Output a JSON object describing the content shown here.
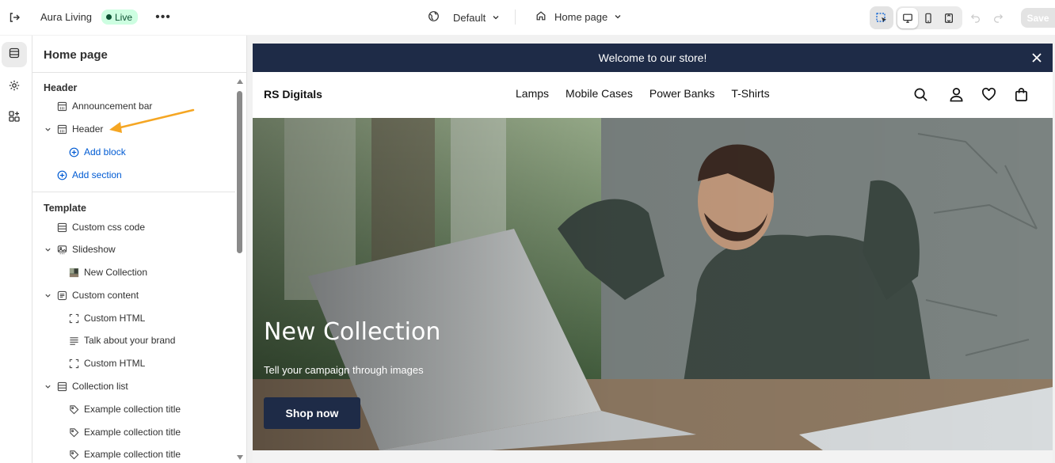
{
  "topbar": {
    "store_name": "Aura Living",
    "live_label": "Live",
    "more_label": "•••",
    "theme_selector": "Default",
    "page_selector": "Home page",
    "save_label": "Save"
  },
  "rail": {
    "items": [
      {
        "name": "sections-icon",
        "active": true
      },
      {
        "name": "settings-gear-icon",
        "active": false
      },
      {
        "name": "apps-icon",
        "active": false
      }
    ]
  },
  "panel": {
    "title": "Home page",
    "header_group": {
      "title": "Header",
      "rows": [
        {
          "label": "Announcement bar",
          "icon": "section-icon"
        },
        {
          "label": "Header",
          "icon": "section-icon",
          "expanded": true
        },
        {
          "label": "Add block",
          "icon": "plus-circle-icon",
          "link": true
        },
        {
          "label": "Add section",
          "icon": "plus-circle-icon",
          "link": true
        }
      ]
    },
    "template_group": {
      "title": "Template",
      "rows": [
        {
          "label": "Custom css code",
          "icon": "section-icon"
        },
        {
          "label": "Slideshow",
          "icon": "slideshow-icon",
          "expanded": true
        },
        {
          "label": "New Collection",
          "icon": "image-thumb-icon"
        },
        {
          "label": "Custom content",
          "icon": "content-icon",
          "expanded": true
        },
        {
          "label": "Custom HTML",
          "icon": "html-frame-icon"
        },
        {
          "label": "Talk about your brand",
          "icon": "text-lines-icon"
        },
        {
          "label": "Custom HTML",
          "icon": "html-frame-icon"
        },
        {
          "label": "Collection list",
          "icon": "section-icon",
          "expanded": true
        },
        {
          "label": "Example collection title",
          "icon": "tag-icon"
        },
        {
          "label": "Example collection title",
          "icon": "tag-icon"
        },
        {
          "label": "Example collection title",
          "icon": "tag-icon"
        }
      ]
    }
  },
  "preview": {
    "announcement": "Welcome to our store!",
    "logo": "RS Digitals",
    "nav": [
      "Lamps",
      "Mobile Cases",
      "Power Banks",
      "T-Shirts"
    ],
    "hero": {
      "title": "New Collection",
      "subtitle": "Tell your campaign through images",
      "button": "Shop now"
    }
  },
  "colors": {
    "announcement_bg": "#1e2b47",
    "live_badge_bg": "#cdfee1",
    "link_blue": "#005bd3",
    "annotation_arrow": "#f5a623"
  }
}
